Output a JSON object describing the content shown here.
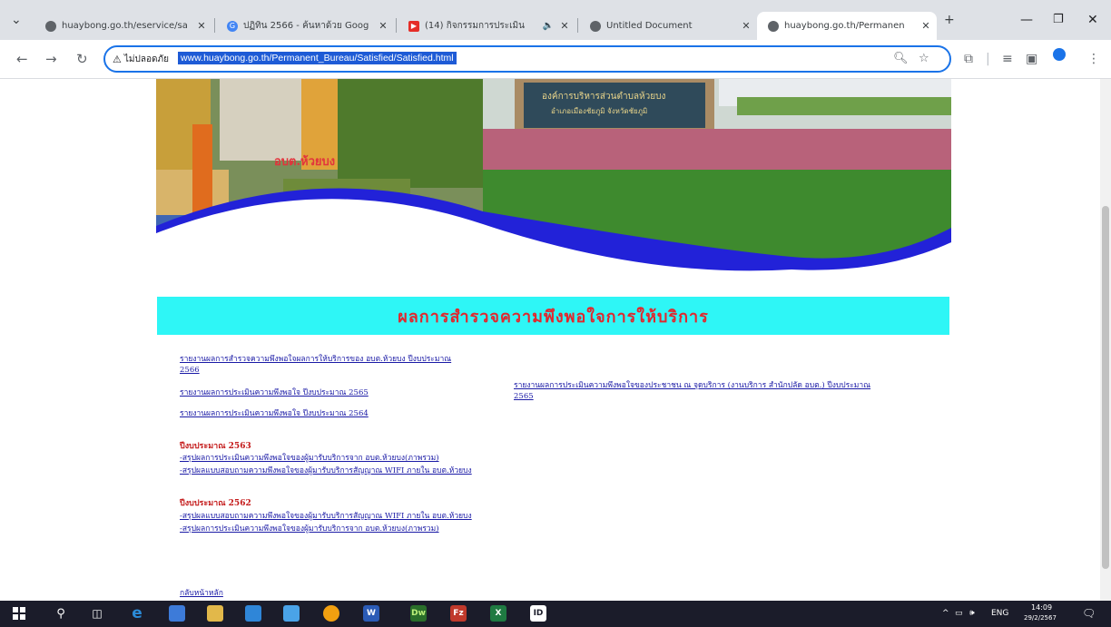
{
  "browser": {
    "tabs": [
      {
        "title": "huaybong.go.th/eservice/sa"
      },
      {
        "title": "ปฏิทิน 2566 - ค้นหาด้วย Goog"
      },
      {
        "title": "(14) กิจกรรมการประเมิน"
      },
      {
        "title": "Untitled Document"
      },
      {
        "title": "huaybong.go.th/Permanen"
      }
    ],
    "security_label": "ไม่ปลอดภัย",
    "url": "www.huaybong.go.th/Permanent_Bureau/Satisfied/Satisfied.html"
  },
  "page": {
    "heading": "ผลการสำรวจความพึงพอใจการให้บริการ",
    "links_left": [
      "รายงานผลการสำรวจความพึงพอใจผลการให้บริการของ อบต.ห้วยบง ปีงบประมาณ",
      "2566",
      "รายงานผลการประเมินความพึงพอใจ ปีงบประมาณ 2565",
      "รายงานผลการประเมินความพึงพอใจ ปีงบประมาณ 2564"
    ],
    "link_right": [
      "รายงานผลการประเมินความพึงพอใจของประชาชน ณ จุดบริการ (งานบริการ สำนักปลัด อบต.) ปีงบประมาณ",
      "2565"
    ],
    "year_2563": {
      "title": "ปีงบประมาณ 2563",
      "links": [
        "-สรุปผลการประเมินความพึงพอใจของผู้มารับบริการจาก อบต.ห้วยบง(ภาพรวม)",
        "-สรุปผลแบบสอบถามความพึงพอใจของผู้มารับบริการสัญญาณ WIFI ภายใน อบต.ห้วยบง"
      ]
    },
    "year_2562": {
      "title": "ปีงบประมาณ 2562",
      "links": [
        "-สรุปผลแบบสอบถามความพึงพอใจของผู้มารับบริการสัญญาณ WIFI ภายใน อบต.ห้วยบง",
        "-สรุปผลการประเมินความพึงพอใจของผู้มารับบริการจาก อบต.ห้วยบง(ภาพรวม)"
      ]
    },
    "back_link": "กลับหน้าหลัก"
  },
  "taskbar": {
    "lang": "ENG",
    "time": "14:09",
    "date": "29/2/2567"
  }
}
